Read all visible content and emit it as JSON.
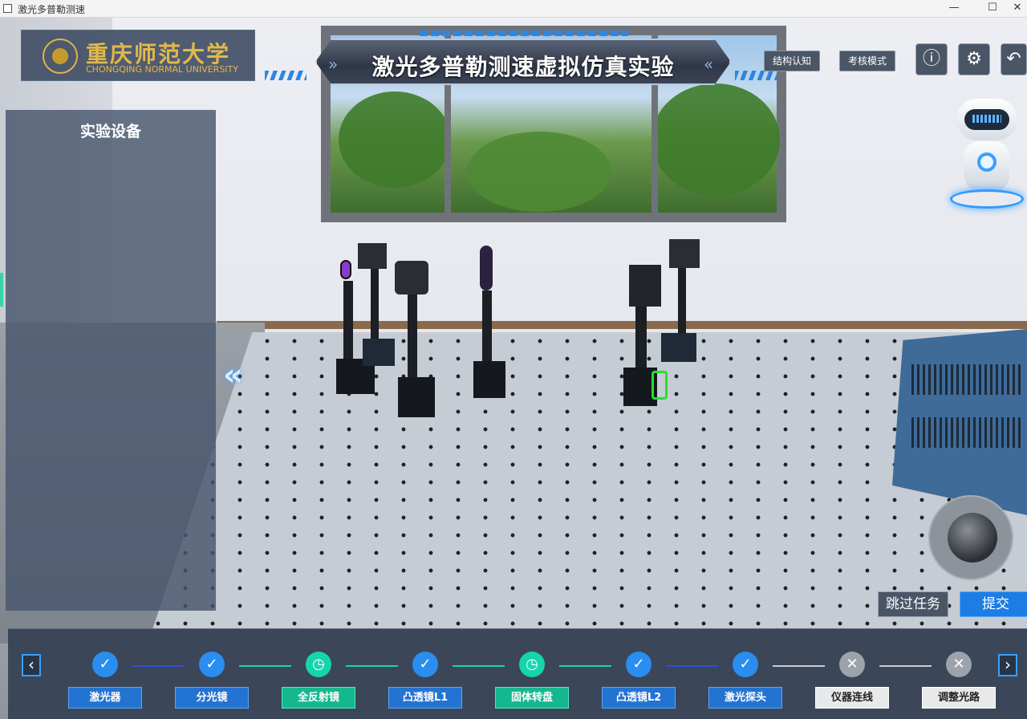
{
  "window": {
    "title": "激光多普勒测速",
    "minimize": "—",
    "maximize": "☐",
    "close": "✕"
  },
  "header": {
    "logo_cn": "重庆师范大学",
    "logo_en": "CHONGQING NORMAL UNIVERSITY",
    "title": "激光多普勒测速虚拟仿真实验",
    "structure_btn": "结构认知",
    "exam_btn": "考核模式",
    "info_icon": "ⓘ",
    "settings_icon": "⚙",
    "back_icon": "↶"
  },
  "left_panel": {
    "title": "实验设备",
    "collapse_icon": "«"
  },
  "actions": {
    "skip": "跳过任务",
    "submit": "提交"
  },
  "stepbar": {
    "prev_icon": "‹",
    "next_icon": "›",
    "steps": [
      {
        "label": "激光器",
        "status": "done",
        "icon": "✓"
      },
      {
        "label": "分光镜",
        "status": "done",
        "icon": "✓"
      },
      {
        "label": "全反射镜",
        "status": "active",
        "icon": "◷"
      },
      {
        "label": "凸透镜L1",
        "status": "done",
        "icon": "✓"
      },
      {
        "label": "固体转盘",
        "status": "active",
        "icon": "◷"
      },
      {
        "label": "凸透镜L2",
        "status": "done",
        "icon": "✓"
      },
      {
        "label": "激光探头",
        "status": "done",
        "icon": "✓"
      },
      {
        "label": "仪器连线",
        "status": "todo",
        "icon": "✕"
      },
      {
        "label": "调整光路",
        "status": "todo",
        "icon": "✕"
      }
    ]
  },
  "colors": {
    "done": "#2a8ef0",
    "active": "#16d5ae",
    "todo": "#9da3ab",
    "accent": "#1e7de4"
  }
}
